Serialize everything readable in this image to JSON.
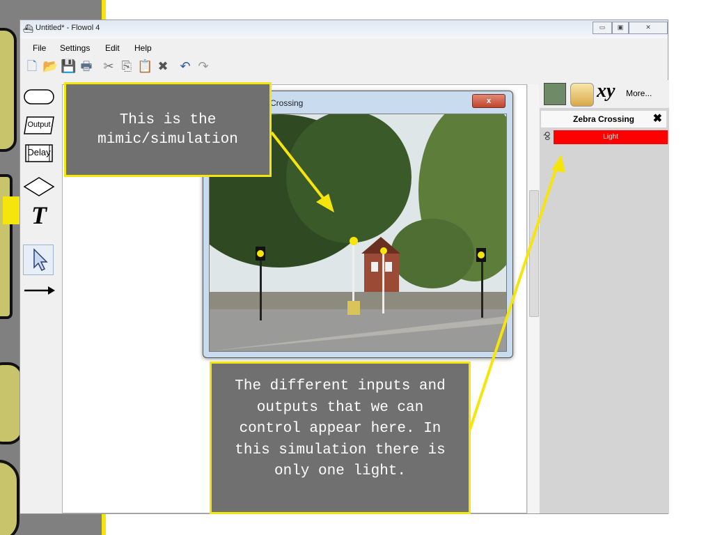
{
  "window": {
    "title": "Untitled* - Flowol 4",
    "controls": [
      "▭",
      "▣",
      "✕"
    ]
  },
  "menu": [
    "File",
    "Settings",
    "Edit",
    "Help"
  ],
  "toolbar_icons": [
    "new-icon",
    "open-icon",
    "save-icon",
    "print-icon",
    "cut-icon",
    "copy-icon",
    "paste-icon",
    "delete-icon",
    "undo-icon",
    "redo-icon"
  ],
  "palette": {
    "output_label": "Output",
    "delay_label": "Delay",
    "text_label": "T"
  },
  "right_panel": {
    "more_label": "More...",
    "xy_label": "xy",
    "mimic_name": "Zebra Crossing",
    "io_prefix": "Q0",
    "io_label": "Light",
    "io_color": "#ff0000"
  },
  "mimic_window": {
    "title": "Crossing",
    "close_label": "x"
  },
  "callouts": {
    "mimic": "This is the mimic/simulation",
    "io": "The different inputs and outputs that we can control appear here. In this simulation there is only one light."
  },
  "accent": "#f5e50a"
}
